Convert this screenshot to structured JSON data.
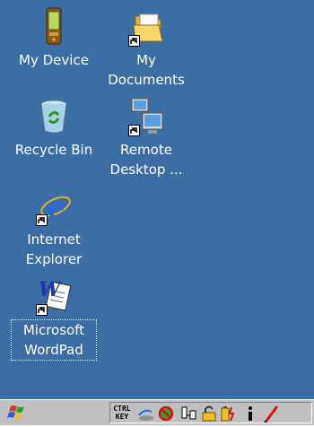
{
  "desktop": {
    "background": "#3a6ea5",
    "icons": [
      {
        "label": "My Device",
        "icon": "pda-device-icon"
      },
      {
        "label": "My\nDocuments",
        "icon": "folder-icon",
        "shortcut": true
      },
      {
        "label": "Recycle Bin",
        "icon": "recycle-bin-icon"
      },
      {
        "label": "Remote\nDesktop ...",
        "icon": "remote-desktop-icon",
        "shortcut": true
      },
      {
        "label": "Internet\nExplorer",
        "icon": "internet-explorer-icon",
        "shortcut": true
      },
      {
        "label": "Microsoft\nWordPad",
        "icon": "wordpad-icon",
        "shortcut": true,
        "selected": true
      }
    ]
  },
  "taskbar": {
    "start_icon": "windows-flag-icon",
    "tray": {
      "ctrl_key_line1": "CTRL",
      "ctrl_key_line2": "KEY",
      "icons": [
        "network-icon",
        "no-sync-icon",
        "connection-icon",
        "lock-icon",
        "battery-icon",
        "info-icon",
        "pen-icon"
      ]
    }
  }
}
